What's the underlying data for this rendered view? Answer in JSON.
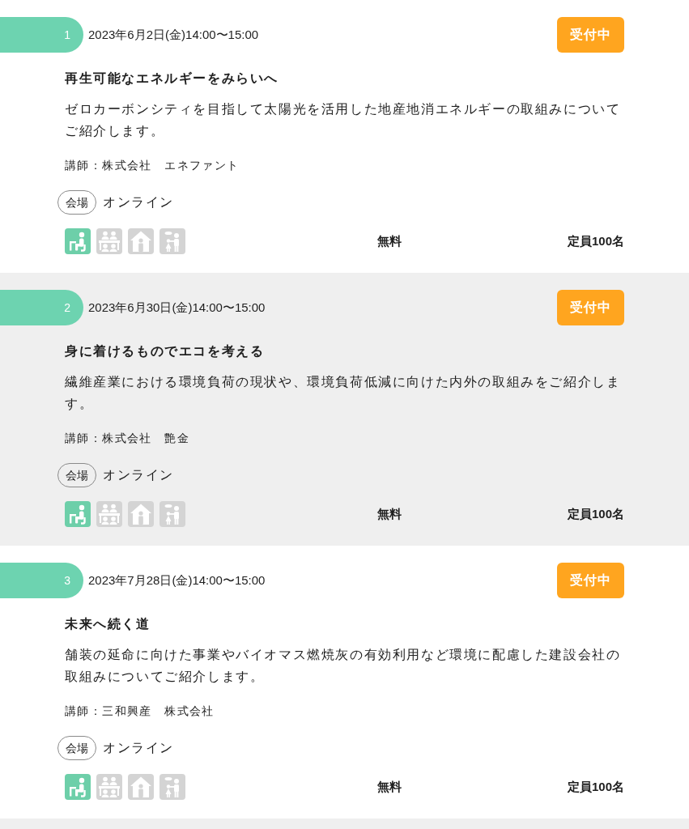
{
  "events": [
    {
      "number": "1",
      "datetime": "2023年6月2日(金)14:00〜15:00",
      "status": "受付中",
      "title": "再生可能なエネルギーをみらいへ",
      "description": "ゼロカーボンシティを目指して太陽光を活用した地産地消エネルギーの取組みについてご紹介します。",
      "lecturer": "講師：株式会社　エネファント",
      "venue_label": "会場",
      "venue": "オンライン",
      "icons": [
        {
          "active": true
        },
        {
          "active": false
        },
        {
          "active": false
        },
        {
          "active": false
        }
      ],
      "fee": "無料",
      "capacity": "定員100名"
    },
    {
      "number": "2",
      "datetime": "2023年6月30日(金)14:00〜15:00",
      "status": "受付中",
      "title": "身に着けるものでエコを考える",
      "description": "繊維産業における環境負荷の現状や、環境負荷低減に向けた内外の取組みをご紹介します。",
      "lecturer": "講師：株式会社　艶金",
      "venue_label": "会場",
      "venue": "オンライン",
      "icons": [
        {
          "active": true
        },
        {
          "active": false
        },
        {
          "active": false
        },
        {
          "active": false
        }
      ],
      "fee": "無料",
      "capacity": "定員100名"
    },
    {
      "number": "3",
      "datetime": "2023年7月28日(金)14:00〜15:00",
      "status": "受付中",
      "title": "未来へ続く道",
      "description": "舗装の延命に向けた事業やバイオマス燃焼灰の有効利用など環境に配慮した建設会社の取組みについてご紹介します。",
      "lecturer": "講師：三和興産　株式会社",
      "venue_label": "会場",
      "venue": "オンライン",
      "icons": [
        {
          "active": true
        },
        {
          "active": false
        },
        {
          "active": false
        },
        {
          "active": false
        }
      ],
      "fee": "無料",
      "capacity": "定員100名"
    }
  ]
}
